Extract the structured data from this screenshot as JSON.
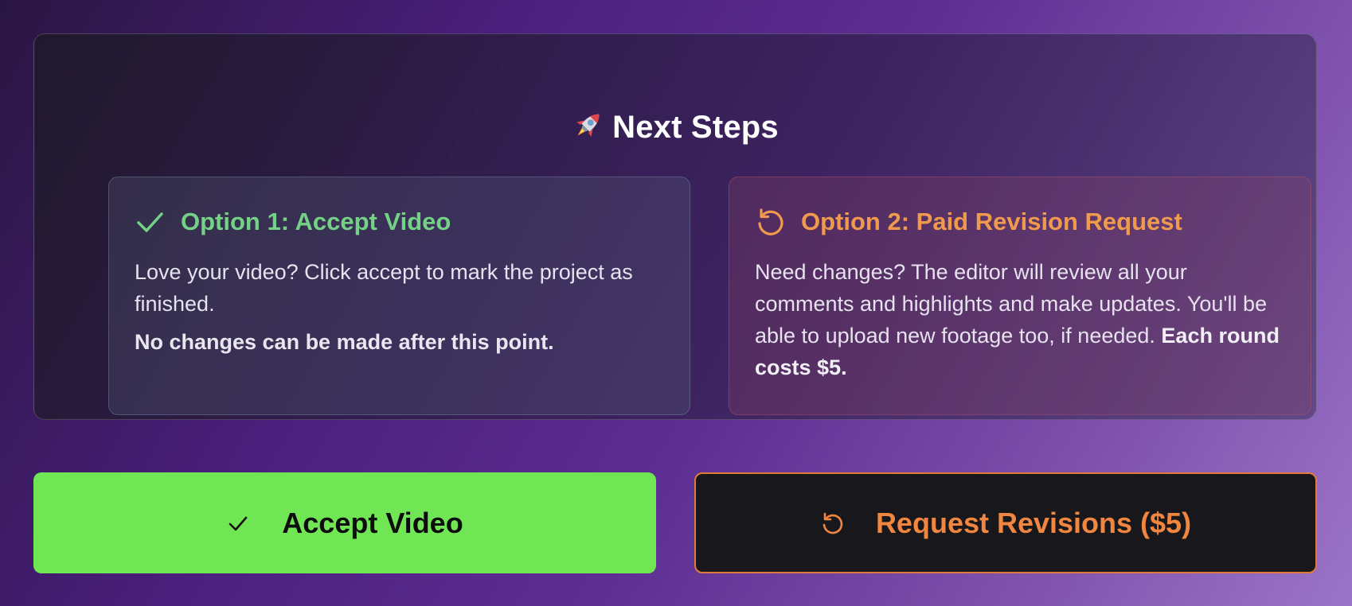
{
  "panel": {
    "title": "Next Steps",
    "title_icon": "rocket-icon"
  },
  "options": {
    "accept": {
      "icon": "check-icon",
      "heading": "Option 1: Accept Video",
      "description": "Love your video? Click accept to mark the project as finished.",
      "warning": "No changes can be made after this point.",
      "accent_color": "#74d186"
    },
    "revision": {
      "icon": "refresh-icon",
      "heading": "Option 2: Paid Revision Request",
      "description": "Need changes? The editor will review all your comments and highlights and make updates. You'll be able to upload new footage too, if needed.",
      "cost_note": "Each round costs $5.",
      "accent_color": "#f09a4e"
    }
  },
  "buttons": {
    "accept": {
      "icon": "check-icon",
      "label": "Accept Video",
      "color": "#70e655"
    },
    "revision": {
      "icon": "refresh-icon",
      "label": "Request Revisions ($5)",
      "color": "#f0863f"
    }
  }
}
